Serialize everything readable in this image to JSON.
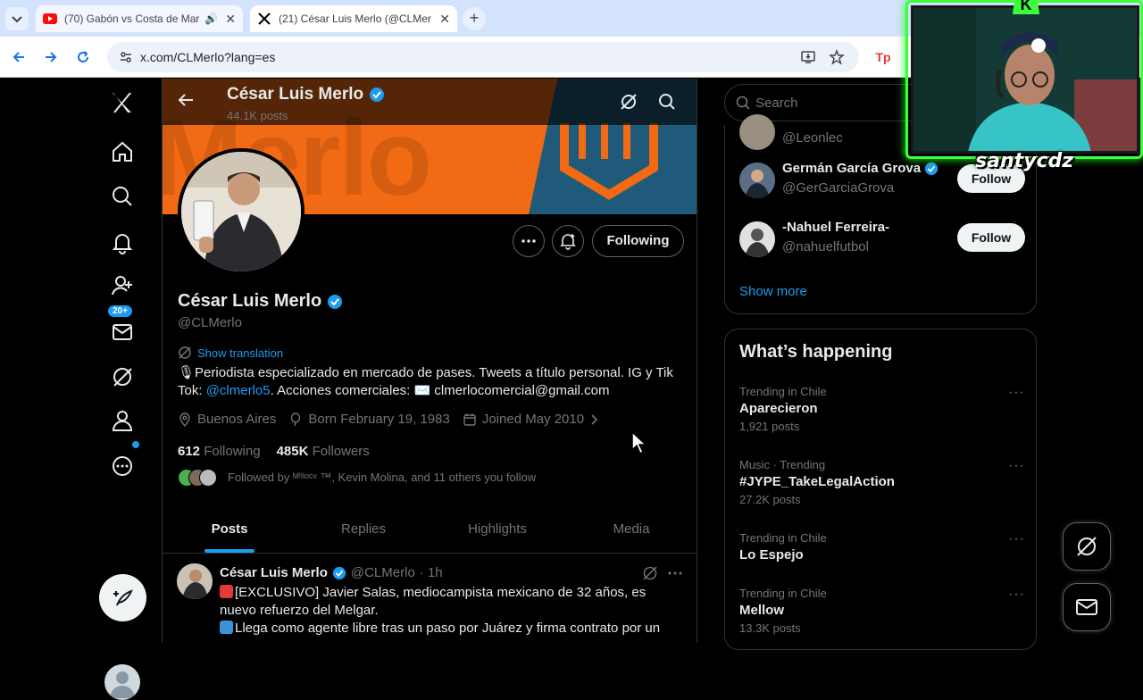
{
  "browser": {
    "tabs": [
      {
        "title": "(70) Gabón vs Costa de Mar",
        "close": "✕"
      },
      {
        "title": "(21) César Luis Merlo (@CLMer",
        "close": "✕"
      }
    ],
    "new_tab": "+",
    "url": "x.com/CLMerlo?lang=es"
  },
  "leftnav": {
    "notif_badge": "20+"
  },
  "header": {
    "name": "César Luis Merlo",
    "posts": "44.1K posts"
  },
  "banner": {
    "text": "Merlo"
  },
  "profile": {
    "following_btn": "Following",
    "name": "César Luis Merlo",
    "handle": "@CLMerlo",
    "show_translation": "Show translation",
    "bio_part1": "Periodista especializado en mercado de pases. Tweets a título personal. IG y Tik Tok: ",
    "bio_link": "@clmerlo5",
    "bio_part2": ". Acciones comerciales: ",
    "bio_email": "clmerlocomercial@gmail.com",
    "location": "Buenos Aires",
    "born": "Born February 19, 1983",
    "joined": "Joined May 2010",
    "following_count": "612",
    "following_label": "Following",
    "followers_count": "485K",
    "followers_label": "Followers",
    "followed_by": "Followed by ᴹⁱˡˡᵒᶜᵛ ™, Kevin Molina, and 11 others you follow"
  },
  "tabs": [
    "Posts",
    "Replies",
    "Highlights",
    "Media"
  ],
  "tweet": {
    "name": "César Luis Merlo",
    "handle": "@CLMerlo",
    "time": "· 1h",
    "line1": "[EXCLUSIVO] Javier Salas, mediocampista mexicano de 32 años, es nuevo refuerzo del Melgar.",
    "line2": "Llega como agente libre tras un paso por Juárez y firma contrato por un"
  },
  "right": {
    "search_placeholder": "Search",
    "who_to_follow": [
      {
        "name": "",
        "handle": "@Leonlec"
      },
      {
        "name": "Germán García Grova",
        "handle": "@GerGarciaGrova",
        "btn": "Follow"
      },
      {
        "name": "-Nahuel Ferreira-",
        "handle": "@nahuelfutbol",
        "btn": "Follow"
      }
    ],
    "show_more": "Show more",
    "whats_happening": "What’s happening",
    "trends": [
      {
        "context": "Trending in Chile",
        "name": "Aparecieron",
        "count": "1,921 posts"
      },
      {
        "context": "Music · Trending",
        "name": "#JYPE_TakeLegalAction",
        "count": "27.2K posts"
      },
      {
        "context": "Trending in Chile",
        "name": "Lo Espejo",
        "count": ""
      },
      {
        "context": "Trending in Chile",
        "name": "Mellow",
        "count": "13.3K posts"
      }
    ],
    "more_dots": "···"
  },
  "stream": {
    "name": "santycdz",
    "logo": "K"
  },
  "colors": {
    "accent": "#1d9bf0",
    "banner_orange": "#f26a14",
    "banner_blue": "#1f5a7a",
    "stream_green": "#3cff3c"
  }
}
